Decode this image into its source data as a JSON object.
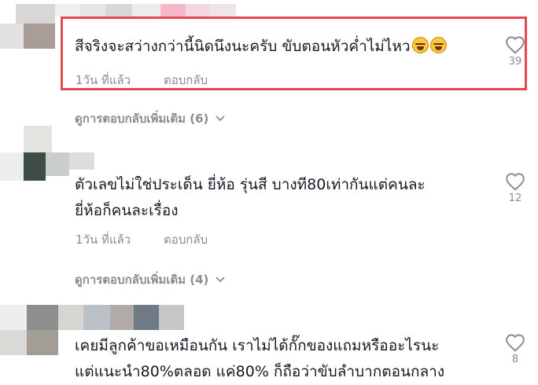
{
  "comments": [
    {
      "text_lines": [
        "สีจริงจะสว่างกว่านี้นิดนึงนะครับ ขับตอนหัวค่ำไม่ไหว"
      ],
      "emoji": [
        "grinning-squinting-face",
        "grinning-squinting-face"
      ],
      "time": "1วัน ที่แล้ว",
      "reply_label": "ตอบกลับ",
      "likes": "39",
      "view_replies": "ดูการตอบกลับเพิ่มเติม (6)",
      "highlighted": true
    },
    {
      "text_lines": [
        "ตัวเลขไม่ใช่ประเด็น ยี่ห้อ รุ่นสี บางที80เท่ากันแต่คนละ",
        "ยี่ห้อก็คนละเรื่อง"
      ],
      "time": "1วัน ที่แล้ว",
      "reply_label": "ตอบกลับ",
      "likes": "12",
      "view_replies": "ดูการตอบกลับเพิ่มเติม (4)"
    },
    {
      "text_lines": [
        "เคยมีลูกค้าขอเหมือนกัน เราไม่ได้กั๊กของแถมหรืออะไรนะ",
        "แต่แนะนำ80%ตลอด แค่80% ก็ถือว่าขับลำบากตอนกลาง"
      ],
      "likes": "8"
    }
  ],
  "colors": {
    "text": "#161823",
    "muted": "#8a8b91",
    "highlight_border": "#e5484d"
  },
  "icons": [
    "heart-outline-icon",
    "chevron-down-icon"
  ]
}
